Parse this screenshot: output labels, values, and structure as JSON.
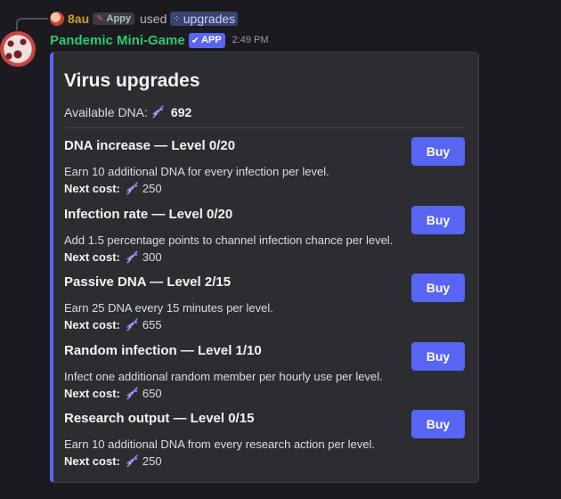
{
  "reply": {
    "username": "8au",
    "tag": "Appy",
    "action": "used",
    "command": "upgrades",
    "icon_user": "user-avatar",
    "icon_tag": "wrench-icon",
    "icon_command": "slash-command-icon"
  },
  "message": {
    "author": "Pandemic Mini-Game",
    "badge": "APP",
    "timestamp": "2:49 PM"
  },
  "embed": {
    "title": "Virus upgrades",
    "available_label": "Available DNA:",
    "available_value": "692",
    "accent_color": "#5865f2"
  },
  "upgrades": [
    {
      "title": "DNA increase — Level 0/20",
      "description": "Earn 10 additional DNA for every infection per level.",
      "cost_label": "Next cost:",
      "cost": "250",
      "button": "Buy"
    },
    {
      "title": "Infection rate — Level 0/20",
      "description": "Add 1.5 percentage points to channel infection chance per level.",
      "cost_label": "Next cost:",
      "cost": "300",
      "button": "Buy"
    },
    {
      "title": "Passive DNA — Level 2/15",
      "description": "Earn 25 DNA every 15 minutes per level.",
      "cost_label": "Next cost:",
      "cost": "655",
      "button": "Buy"
    },
    {
      "title": "Random infection — Level 1/10",
      "description": "Infect one additional random member per hourly use per level.",
      "cost_label": "Next cost:",
      "cost": "650",
      "button": "Buy"
    },
    {
      "title": "Research output — Level 0/15",
      "description": "Earn 10 additional DNA from every research action per level.",
      "cost_label": "Next cost:",
      "cost": "250",
      "button": "Buy"
    }
  ]
}
